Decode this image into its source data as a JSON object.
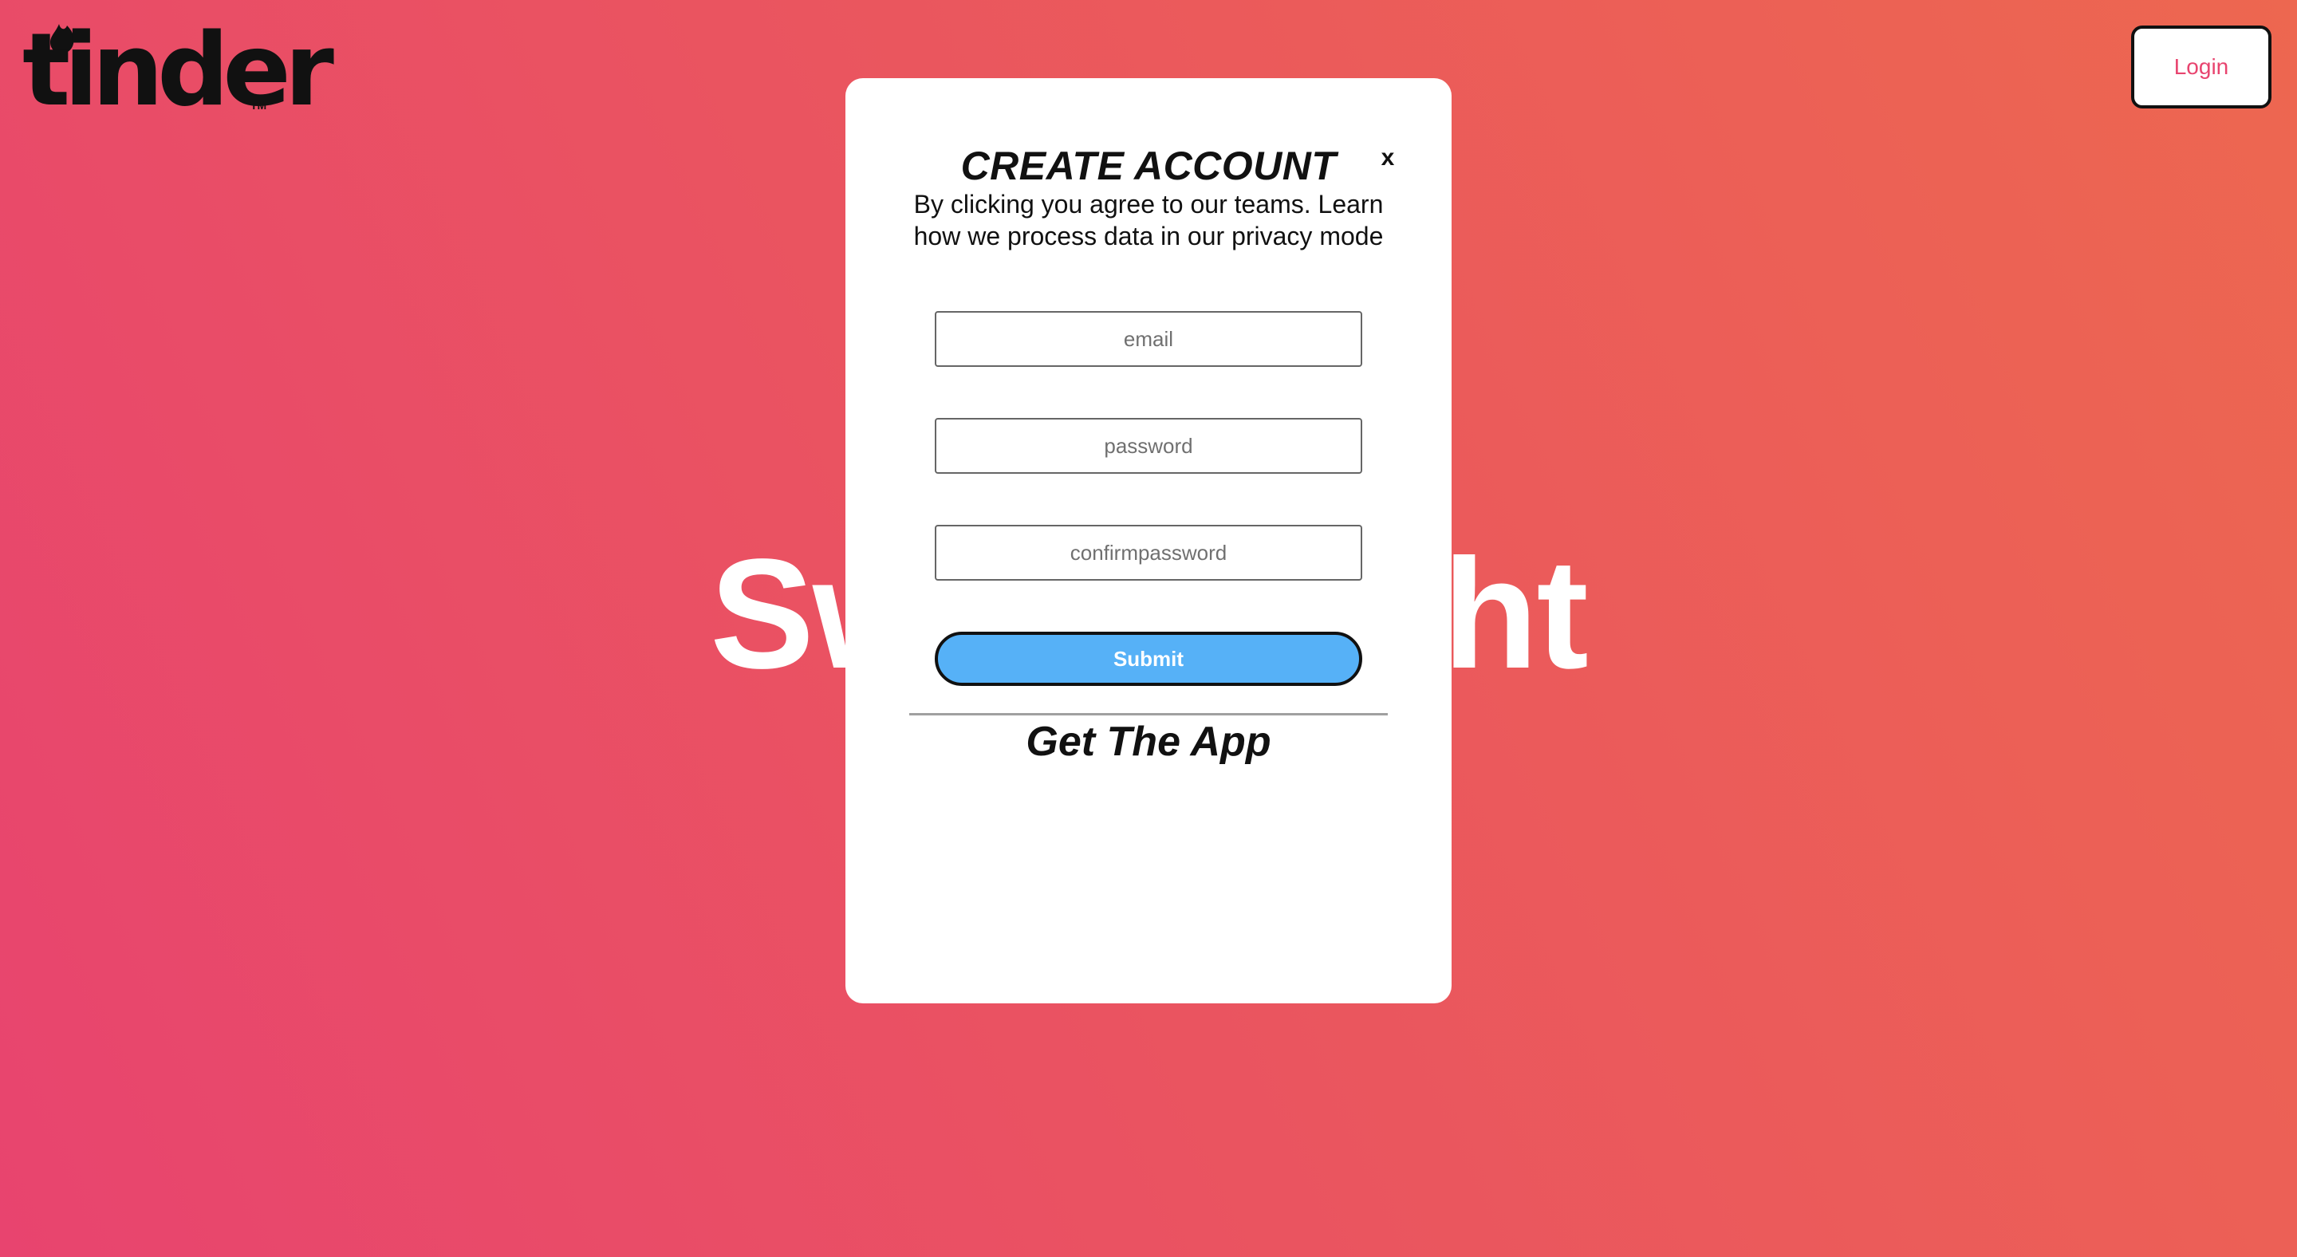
{
  "brand": {
    "name": "tinder",
    "trademark": "TM"
  },
  "header": {
    "login_label": "Login"
  },
  "hero": {
    "title": "Swipe Right"
  },
  "modal": {
    "close_label": "x",
    "title": "CREATE ACCOUNT",
    "subtitle": "By clicking you agree to our teams. Learn how we process data in our privacy mode",
    "email_placeholder": "email",
    "password_placeholder": "password",
    "confirm_placeholder": "confirmpassword",
    "submit_label": "Submit",
    "get_app_label": "Get The App"
  },
  "colors": {
    "gradient_start": "#e8446f",
    "gradient_end": "#ed6750",
    "submit": "#56b1f7",
    "login_text": "#e8446f"
  },
  "icons": {
    "logo_flame": "flame-icon"
  }
}
